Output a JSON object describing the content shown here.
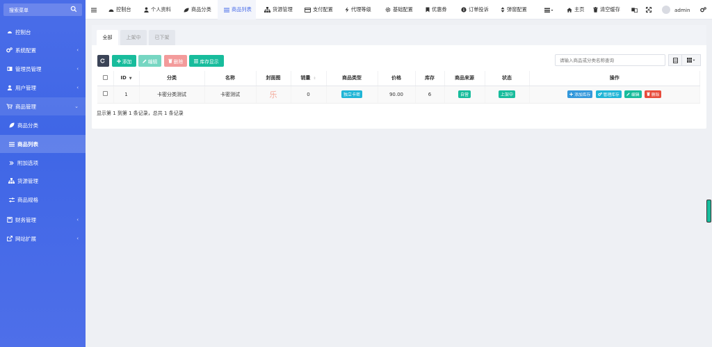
{
  "sidebar": {
    "search_placeholder": "搜索菜单",
    "items": [
      {
        "label": "控制台"
      },
      {
        "label": "系统配置"
      },
      {
        "label": "管理员管理"
      },
      {
        "label": "用户管理"
      },
      {
        "label": "商品管理"
      },
      {
        "label": "商品分类"
      },
      {
        "label": "商品列表"
      },
      {
        "label": "附加选项"
      },
      {
        "label": "货源管理"
      },
      {
        "label": "商品规格"
      },
      {
        "label": "财务管理"
      },
      {
        "label": "网站扩展"
      }
    ]
  },
  "topnav": {
    "items": [
      {
        "label": "控制台"
      },
      {
        "label": "个人资料"
      },
      {
        "label": "商品分类"
      },
      {
        "label": "商品列表"
      },
      {
        "label": "货源管理"
      },
      {
        "label": "支付配置"
      },
      {
        "label": "代理等级"
      },
      {
        "label": "基础配置"
      },
      {
        "label": "优惠券"
      },
      {
        "label": "订单投诉"
      },
      {
        "label": "弹窗配置"
      }
    ],
    "home": "主页",
    "clear_cache": "清空缓存",
    "user": "admin"
  },
  "tabs": [
    {
      "label": "全部"
    },
    {
      "label": "上架中"
    },
    {
      "label": "已下架"
    }
  ],
  "toolbar": {
    "add": "添加",
    "edit": "编辑",
    "delete": "删除",
    "stock": "库存显示",
    "search_placeholder": "请输入商品或分类名称查询"
  },
  "table": {
    "headers": {
      "id": "ID",
      "category": "分类",
      "name": "名称",
      "cover": "封面图",
      "sales": "销量",
      "type": "商品类型",
      "price": "价格",
      "stock": "库存",
      "source": "商品来源",
      "status": "状态",
      "actions": "操作"
    },
    "rows": [
      {
        "id": "1",
        "category": "卡密分类测试",
        "name": "卡密测试",
        "cover": "乐",
        "sales": "0",
        "type": "独立卡密",
        "price": "90.00",
        "stock": "6",
        "source": "自营",
        "status": "上架中",
        "actions": {
          "add_stock": "添加库存",
          "manage_stock": "管理库存",
          "edit": "编辑",
          "delete": "删除"
        }
      }
    ],
    "summary": "显示第 1 到第 1 条记录，总共 1 条记录"
  },
  "colors": {
    "sidebar": "#4a6de8",
    "accent": "#4a6de8",
    "success": "#18bc9c",
    "danger": "#e74c3c",
    "info": "#1fb5d6",
    "primary": "#3498db"
  }
}
